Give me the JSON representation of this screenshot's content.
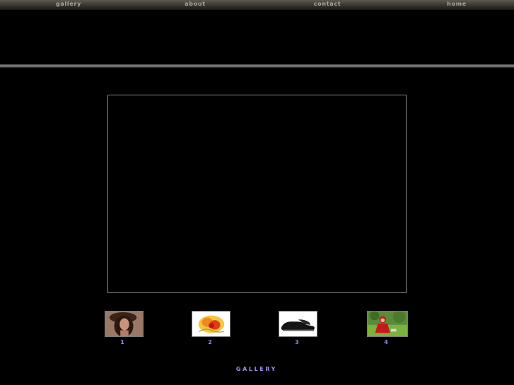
{
  "nav": {
    "items": [
      {
        "label": "gallery"
      },
      {
        "label": "about"
      },
      {
        "label": "contact"
      },
      {
        "label": "home"
      }
    ]
  },
  "thumbnails": [
    {
      "number": "1",
      "subject": "woman-with-hat-photo"
    },
    {
      "number": "2",
      "subject": "painted-flower-photo"
    },
    {
      "number": "3",
      "subject": "black-shoe-photo"
    },
    {
      "number": "4",
      "subject": "girl-in-red-dress-photo"
    }
  ],
  "footer": {
    "title": "GALLERY"
  },
  "colors": {
    "background": "#000000",
    "nav_text": "#a8a8a0",
    "thumb_number": "#8a8ad8",
    "footer_title": "#9c92e8",
    "viewer_border": "#8a8a8a"
  }
}
